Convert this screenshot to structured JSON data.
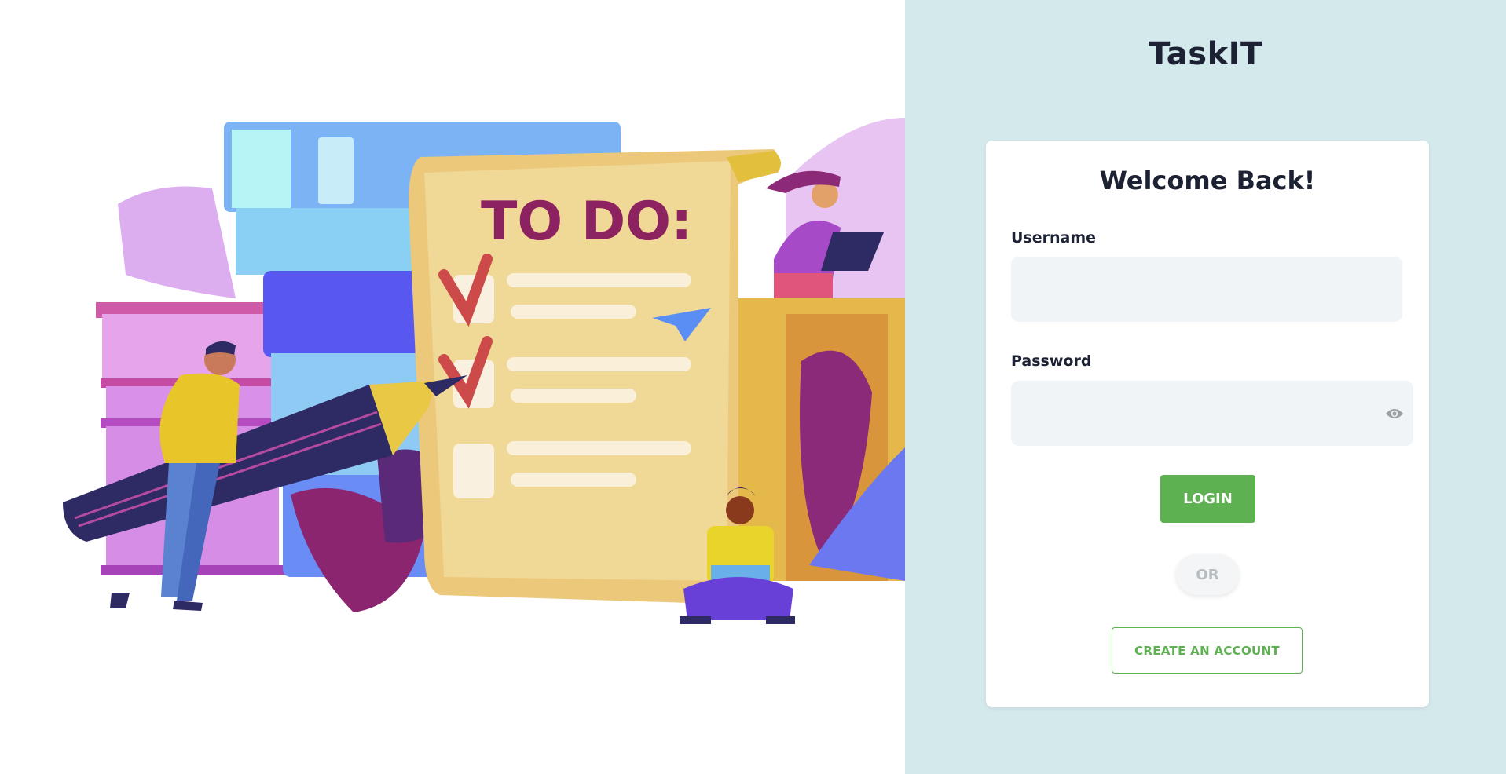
{
  "app": {
    "title": "TaskIT"
  },
  "login_card": {
    "title": "Welcome Back!",
    "username": {
      "label": "Username",
      "value": "",
      "placeholder": ""
    },
    "password": {
      "label": "Password",
      "value": "",
      "placeholder": ""
    },
    "login_button": "LOGIN",
    "or_text": "OR",
    "create_account_button": "CREATE AN ACCOUNT"
  },
  "illustration": {
    "heading_text": "TO DO:"
  },
  "colors": {
    "brand_green": "#5db150",
    "panel_background": "#d4e9ec",
    "text_dark": "#1c2133",
    "input_background": "#f0f4f6"
  },
  "icons": {
    "password_toggle": "eye-icon"
  }
}
